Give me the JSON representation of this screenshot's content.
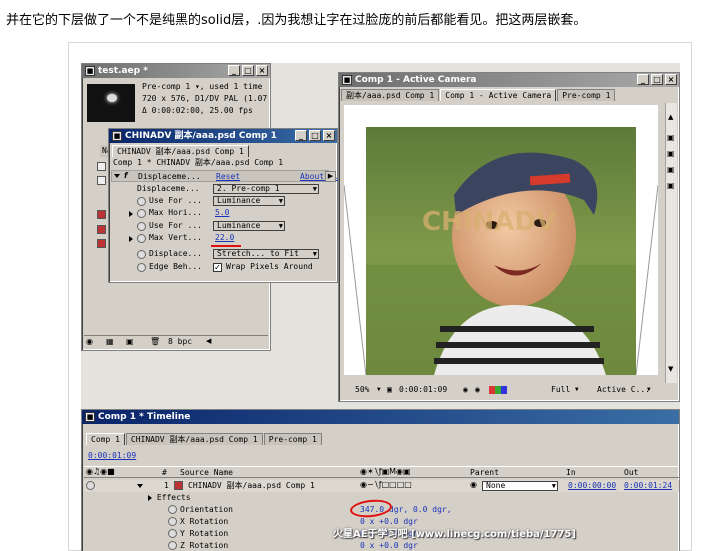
{
  "intro_text": "并在它的下层做了一个不是纯黑的solid层，.因为我想让字在过脸庞的前后都能看见。把这两层嵌套。",
  "project": {
    "title": "test.aep *",
    "info_lines": [
      "Pre-comp 1 ▾, used 1 time",
      "720 x 576, D1/DV PAL (1.07",
      "Δ 0:00:02:00, 25.00 fps"
    ],
    "column_header": "Na",
    "footer_bpc": "8 bpc"
  },
  "effect_controls": {
    "title": "CHINADV 副本/aaa.psd Comp 1",
    "tab_label": "CHINADV 副本/aaa.psd Comp 1",
    "breadcrumb": "Comp 1 * CHINADV 副本/aaa.psd Comp 1",
    "effect_name": "Displaceme...",
    "reset_label": "Reset",
    "about_label": "About...",
    "props": [
      {
        "label": "Displaceme...",
        "value": "2. Pre-comp 1"
      },
      {
        "label": "Use For ...",
        "value": "Luminance"
      },
      {
        "label": "Max Hori...",
        "value": "5.0"
      },
      {
        "label": "Use For ...",
        "value": "Luminance"
      },
      {
        "label": "Max Vert...",
        "value": "22.0"
      },
      {
        "label": "Displace...",
        "value": "Stretch... to Fit"
      },
      {
        "label": "Edge Beh...",
        "value": "Wrap Pixels Around"
      }
    ]
  },
  "comp_viewer": {
    "title": "Comp 1 - Active Camera",
    "tabs": [
      "副本/aaa.psd Comp 1",
      "Comp 1 - Active Camera",
      "Pre-comp 1"
    ],
    "watermark_text": "CHINADV",
    "zoom": "50%",
    "timecode": "0:00:01:09",
    "resolution": "Full",
    "camera": "Active C..."
  },
  "timeline": {
    "title": "Comp 1 * Timeline",
    "tabs": [
      "Comp 1",
      "CHINADV 副本/aaa.psd Comp 1",
      "Pre-comp 1"
    ],
    "timecode": "0:00:01:09",
    "headers": {
      "num": "#",
      "source": "Source Name",
      "parent": "Parent",
      "in": "In",
      "out": "Out"
    },
    "layer": {
      "index": "1",
      "name": "CHINADV 副本/aaa.psd Comp 1",
      "parent": "None",
      "in": "0:00:00:00",
      "out": "0:00:01:24"
    },
    "effects_label": "Effects",
    "props": [
      {
        "label": "Orientation",
        "value": "347.0 dgr, 0.0 dgr,"
      },
      {
        "label": "X Rotation",
        "value": "0 x +0.0 dgr"
      },
      {
        "label": "Y Rotation",
        "value": "0 x +0.0 dgr"
      },
      {
        "label": "Z Rotation",
        "value": "0 x +0.0 dgr"
      }
    ]
  },
  "site_watermark": "火星AE于学习吧 [www.linecg.com/tieba/1775]",
  "colors": {
    "accent_link": "#1a32b8",
    "title_active": "#0a246a",
    "annotation_red": "#e01010"
  }
}
